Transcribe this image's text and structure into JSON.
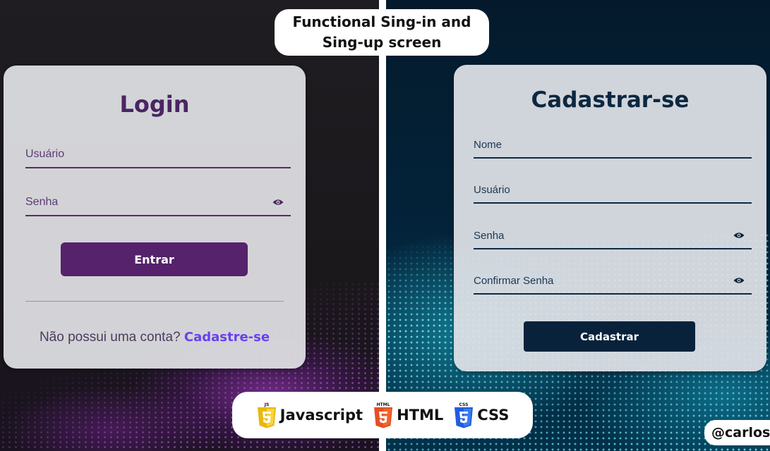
{
  "header": {
    "title_line1": "Functional Sing-in and",
    "title_line2": "Sing-up screen"
  },
  "login": {
    "title": "Login",
    "username_placeholder": "Usuário",
    "password_placeholder": "Senha",
    "submit_label": "Entrar",
    "no_account_text": "Não possui uma conta?",
    "signup_link": "Cadastre-se",
    "accent_color": "#55226b"
  },
  "signup": {
    "title": "Cadastrar-se",
    "name_placeholder": "Nome",
    "username_placeholder": "Usuário",
    "password_placeholder": "Senha",
    "confirm_password_placeholder": "Confirmar Senha",
    "submit_label": "Cadastrar",
    "accent_color": "#07223a"
  },
  "tech": {
    "items": [
      {
        "icon": "js-shield-icon",
        "badge": "JS",
        "label": "Javascript",
        "color": "#f0c419"
      },
      {
        "icon": "html5-shield-icon",
        "badge": "HTML",
        "label": "HTML",
        "color": "#e44d26"
      },
      {
        "icon": "css3-shield-icon",
        "badge": "CSS",
        "label": "CSS",
        "color": "#2862e9"
      }
    ]
  },
  "handle": "@carlosv"
}
